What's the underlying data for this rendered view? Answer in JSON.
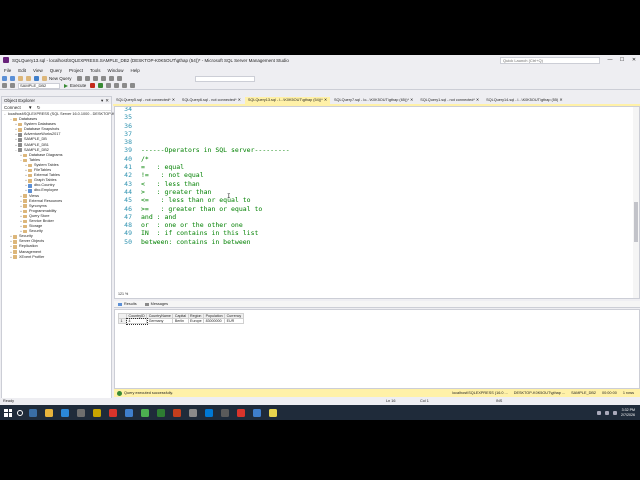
{
  "window": {
    "title": "SQLQuery13.sql - localhost\\SQLEXPRESS.SAMPLE_DB2 (DESKTOP-K0K5OUT\\gthap (54))* - Microsoft SQL Server Management Studio",
    "quick_launch_placeholder": "Quick Launch (Ctrl+Q)"
  },
  "menu": [
    "File",
    "Edit",
    "View",
    "Query",
    "Project",
    "Tools",
    "Window",
    "Help"
  ],
  "toolbar": {
    "new_query_label": "New Query",
    "database_selected": "SAMPLE_DB2",
    "execute_label": "Execute"
  },
  "object_explorer": {
    "title": "Object Explorer",
    "connect_label": "Connect",
    "nodes": [
      {
        "label": "localhost\\SQLEXPRESS (SQL Server 16.0.1000 - DESKTOP-K0K5OUT\\gthap)",
        "depth": 0,
        "icon": "server",
        "expander": "−"
      },
      {
        "label": "Databases",
        "depth": 1,
        "icon": "folder",
        "expander": "−"
      },
      {
        "label": "System Databases",
        "depth": 2,
        "icon": "folder",
        "expander": "+"
      },
      {
        "label": "Database Snapshots",
        "depth": 2,
        "icon": "folder",
        "expander": "+"
      },
      {
        "label": "AdventureWorks2017",
        "depth": 2,
        "icon": "db",
        "expander": "+"
      },
      {
        "label": "SAMPLE_DB",
        "depth": 2,
        "icon": "db",
        "expander": "+"
      },
      {
        "label": "SAMPLE_DB1",
        "depth": 2,
        "icon": "db",
        "expander": "+"
      },
      {
        "label": "SAMPLE_DB2",
        "depth": 2,
        "icon": "db",
        "expander": "−"
      },
      {
        "label": "Database Diagrams",
        "depth": 3,
        "icon": "folder",
        "expander": "+"
      },
      {
        "label": "Tables",
        "depth": 3,
        "icon": "folder",
        "expander": "−"
      },
      {
        "label": "System Tables",
        "depth": 4,
        "icon": "folder",
        "expander": "+"
      },
      {
        "label": "FileTables",
        "depth": 4,
        "icon": "folder",
        "expander": "+"
      },
      {
        "label": "External Tables",
        "depth": 4,
        "icon": "folder",
        "expander": "+"
      },
      {
        "label": "Graph Tables",
        "depth": 4,
        "icon": "folder",
        "expander": "+"
      },
      {
        "label": "dbo.Country",
        "depth": 4,
        "icon": "table",
        "expander": "+"
      },
      {
        "label": "dbo.Employee",
        "depth": 4,
        "icon": "table",
        "expander": "+"
      },
      {
        "label": "Views",
        "depth": 3,
        "icon": "folder",
        "expander": "+"
      },
      {
        "label": "External Resources",
        "depth": 3,
        "icon": "folder",
        "expander": "+"
      },
      {
        "label": "Synonyms",
        "depth": 3,
        "icon": "folder",
        "expander": "+"
      },
      {
        "label": "Programmability",
        "depth": 3,
        "icon": "folder",
        "expander": "+"
      },
      {
        "label": "Query Store",
        "depth": 3,
        "icon": "folder",
        "expander": "+"
      },
      {
        "label": "Service Broker",
        "depth": 3,
        "icon": "folder",
        "expander": "+"
      },
      {
        "label": "Storage",
        "depth": 3,
        "icon": "folder",
        "expander": "+"
      },
      {
        "label": "Security",
        "depth": 3,
        "icon": "folder",
        "expander": "+"
      },
      {
        "label": "Security",
        "depth": 1,
        "icon": "folder",
        "expander": "+"
      },
      {
        "label": "Server Objects",
        "depth": 1,
        "icon": "folder",
        "expander": "+"
      },
      {
        "label": "Replication",
        "depth": 1,
        "icon": "folder",
        "expander": "+"
      },
      {
        "label": "Management",
        "depth": 1,
        "icon": "folder",
        "expander": "+"
      },
      {
        "label": "XEvent Profiler",
        "depth": 1,
        "icon": "folder",
        "expander": "+"
      }
    ]
  },
  "doc_tabs": [
    {
      "label": "SQLQuery5.sql - not connected*",
      "active": false
    },
    {
      "label": "SQLQuery6.sql - not connected*",
      "active": false
    },
    {
      "label": "SQLQuery13.sql - l...\\K0K5OUT\\gthap (54))*",
      "active": true
    },
    {
      "label": "SQLQuery7.sql - lo...\\K0K5OUT\\gthap (65))*",
      "active": false
    },
    {
      "label": "SQLQuery1.sql - not connected*",
      "active": false
    },
    {
      "label": "SQLQuery14.sql - l...\\K0K5OUT\\gthap (55)",
      "active": false
    }
  ],
  "editor": {
    "lines": [
      {
        "num": "34",
        "text": ""
      },
      {
        "num": "35",
        "text": ""
      },
      {
        "num": "36",
        "text": ""
      },
      {
        "num": "37",
        "text": ""
      },
      {
        "num": "38",
        "text": ""
      },
      {
        "num": "39",
        "text": "------Operators in SQL server---------"
      },
      {
        "num": "40",
        "text": "/*"
      },
      {
        "num": "41",
        "text": "=   : equal"
      },
      {
        "num": "42",
        "text": "!=   : not equal"
      },
      {
        "num": "43",
        "text": "<   : less than"
      },
      {
        "num": "44",
        "text": ">   : greater than"
      },
      {
        "num": "45",
        "text": "<=   : less than or equal to"
      },
      {
        "num": "46",
        "text": ">=   : greater than or equal to"
      },
      {
        "num": "47",
        "text": "and : and"
      },
      {
        "num": "48",
        "text": "or  : one or the other one"
      },
      {
        "num": "49",
        "text": "IN  : if contains in this list"
      },
      {
        "num": "50",
        "text": "between: contains in between"
      }
    ],
    "ibeam": "I",
    "zoom": "121 %"
  },
  "results": {
    "tabs": [
      "Results",
      "Messages"
    ],
    "columns": [
      "CountryID",
      "CountryName",
      "Capital",
      "Region",
      "Population",
      "Currency"
    ],
    "rows": [
      {
        "num": "1",
        "cells": [
          "4",
          "Germany",
          "Berlin",
          "Europe",
          "83000000",
          "EUR"
        ]
      }
    ]
  },
  "query_status": {
    "message": "Query executed successfully.",
    "server": "localhost\\SQLEXPRESS (16.0 ...",
    "user": "DESKTOP-K0K5OUT\\gthap ...",
    "database": "SAMPLE_DB2",
    "time": "00:00:00",
    "rows": "1 rows"
  },
  "status_bar": {
    "ready": "Ready",
    "ln": "Ln 16",
    "col": "Col 1",
    "ins": "INS"
  },
  "taskbar": {
    "time": "3:32 PM",
    "date": "2/7/2026"
  },
  "colors": {
    "accent_tab": "#fff1a8",
    "comment_green": "#008000",
    "line_number": "#2b91af",
    "taskbar": "#1f2b3a"
  }
}
